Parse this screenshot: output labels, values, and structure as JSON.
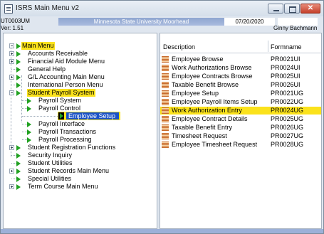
{
  "window": {
    "title": "ISRS Main Menu v2"
  },
  "info": {
    "user_id": "UT0003UM",
    "version": "Ver:  1.51",
    "university": "Minnesota State University Moorhead",
    "date": "07/20/2020",
    "user_name": "Ginny Bachmann"
  },
  "tree": {
    "root": "Main Menu",
    "items": [
      "Accounts Receivable",
      "Financial Aid Module Menu",
      "General Help",
      "G/L Accounting Main Menu",
      "International Person Menu",
      "Student Payroll System",
      "Payroll System",
      "Payroll Control",
      "Employee Setup",
      "Payroll Interface",
      "Payroll Transactions",
      "Payroll Processing",
      "Student Registration Functions",
      "Security Inquiry",
      "Student Utilities",
      "Student Records Main Menu",
      "Special Utilities",
      "Term Course Main Menu"
    ]
  },
  "table": {
    "headers": [
      "Description",
      "Formname"
    ],
    "rows": [
      [
        "Employee Browse",
        "PR0021UI"
      ],
      [
        "Work Authorizations Browse",
        "PR0024UI"
      ],
      [
        "Employee Contracts Browse",
        "PR0025UI"
      ],
      [
        "Taxable Benefit Browse",
        "PR0026UI"
      ],
      [
        "Employee Setup",
        "PR0021UG"
      ],
      [
        "Employee Payroll Items Setup",
        "PR0022UG"
      ],
      [
        "Work Authorization Entry",
        "PR0024UG"
      ],
      [
        "Employee Contract Details",
        "PR0025UG"
      ],
      [
        "Taxable Benefit Entry",
        "PR0026UG"
      ],
      [
        "Timesheet Request",
        "PR0027UG"
      ],
      [
        "Employee Timesheet Request",
        "PR0028UG"
      ]
    ]
  },
  "colors": {
    "highlight": "#fbe21c",
    "selection": "#1b53c8",
    "tree_icon": "#21a121",
    "university_bar": "#8fa6d0"
  }
}
